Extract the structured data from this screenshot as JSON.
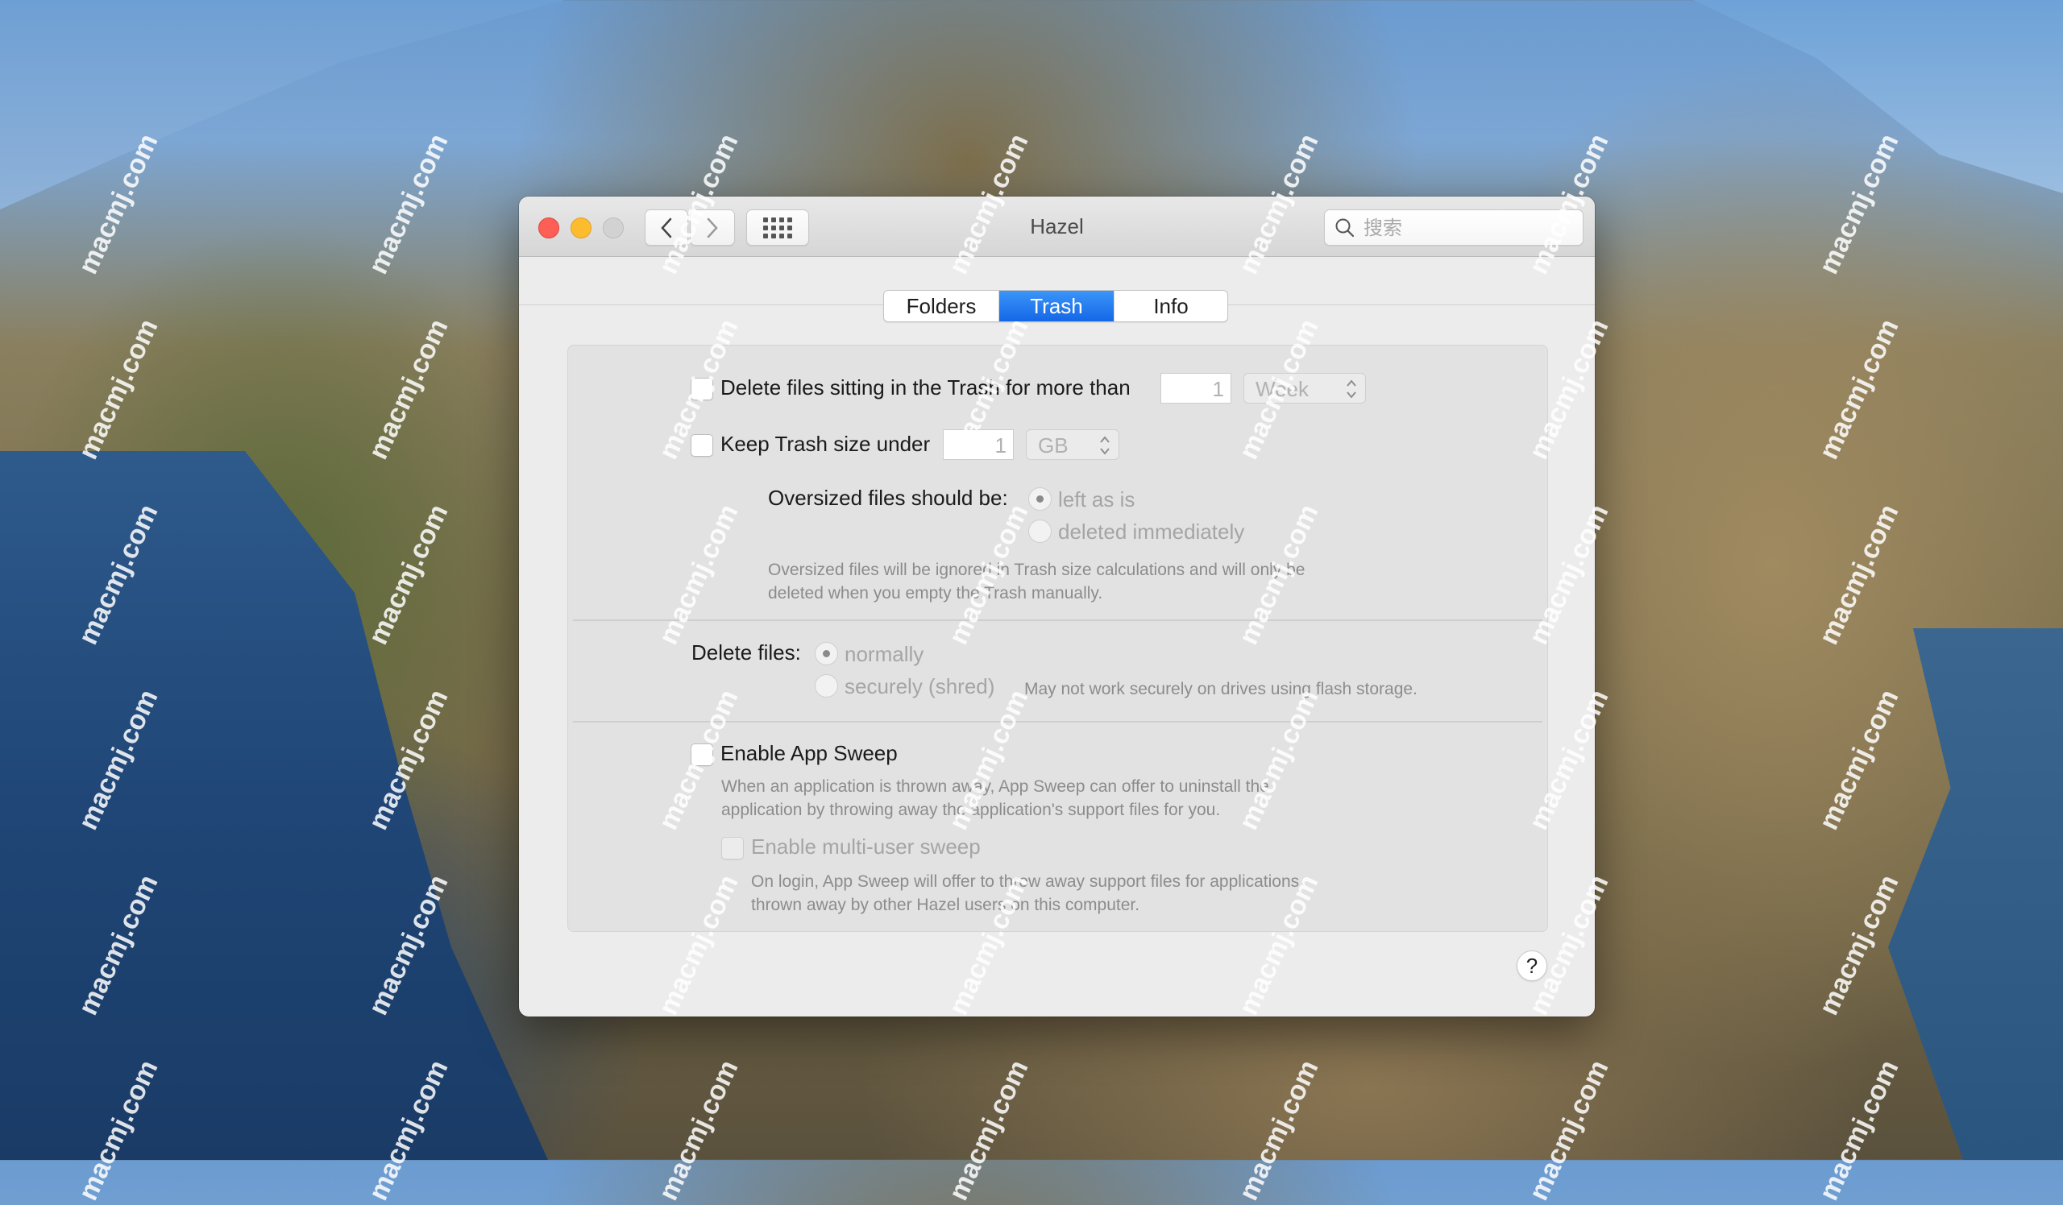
{
  "window": {
    "title": "Hazel",
    "traffic_lights": {
      "close": "#fd5f57",
      "minimize": "#fdbc2e",
      "zoom": "#d2d2d2"
    },
    "nav": {
      "back_icon": "chevron-left-icon",
      "forward_icon": "chevron-right-icon",
      "grid_icon": "show-all-grid-icon"
    },
    "search": {
      "placeholder": "搜索",
      "value": "",
      "icon": "search-icon"
    }
  },
  "tabs": [
    {
      "label": "Folders",
      "active": false
    },
    {
      "label": "Trash",
      "active": true
    },
    {
      "label": "Info",
      "active": false
    }
  ],
  "accent_color": "#1a6ff0",
  "trash": {
    "delete_old": {
      "checked": false,
      "label": "Delete files sitting in the Trash for more than",
      "amount": "1",
      "unit": "Week"
    },
    "size_limit": {
      "checked": false,
      "label": "Keep Trash size under",
      "amount": "1",
      "unit": "GB"
    },
    "oversized": {
      "label": "Oversized files should be:",
      "options": [
        {
          "label": "left as is",
          "selected": true
        },
        {
          "label": "deleted immediately",
          "selected": false
        }
      ],
      "note_line1": "Oversized files will be ignored in Trash size calculations and will only be",
      "note_line2": "deleted when you empty the Trash manually."
    },
    "delete_mode": {
      "label": "Delete files:",
      "options": [
        {
          "label": "normally",
          "selected": true
        },
        {
          "label": "securely (shred)",
          "selected": false
        }
      ],
      "note": "May not work securely on drives using flash storage."
    },
    "app_sweep": {
      "checked": false,
      "label": "Enable App Sweep",
      "note_line1": "When an application is thrown away, App Sweep can offer to uninstall the",
      "note_line2": "application by throwing away the application's support files for you.",
      "multi_user": {
        "checked": false,
        "enabled": false,
        "label": "Enable multi-user sweep",
        "note_line1": "On login, App Sweep will offer to throw away support files for applications",
        "note_line2": "thrown away by other Hazel users on this computer."
      }
    }
  },
  "help_button": {
    "label": "?"
  },
  "watermark": "macmj.com"
}
